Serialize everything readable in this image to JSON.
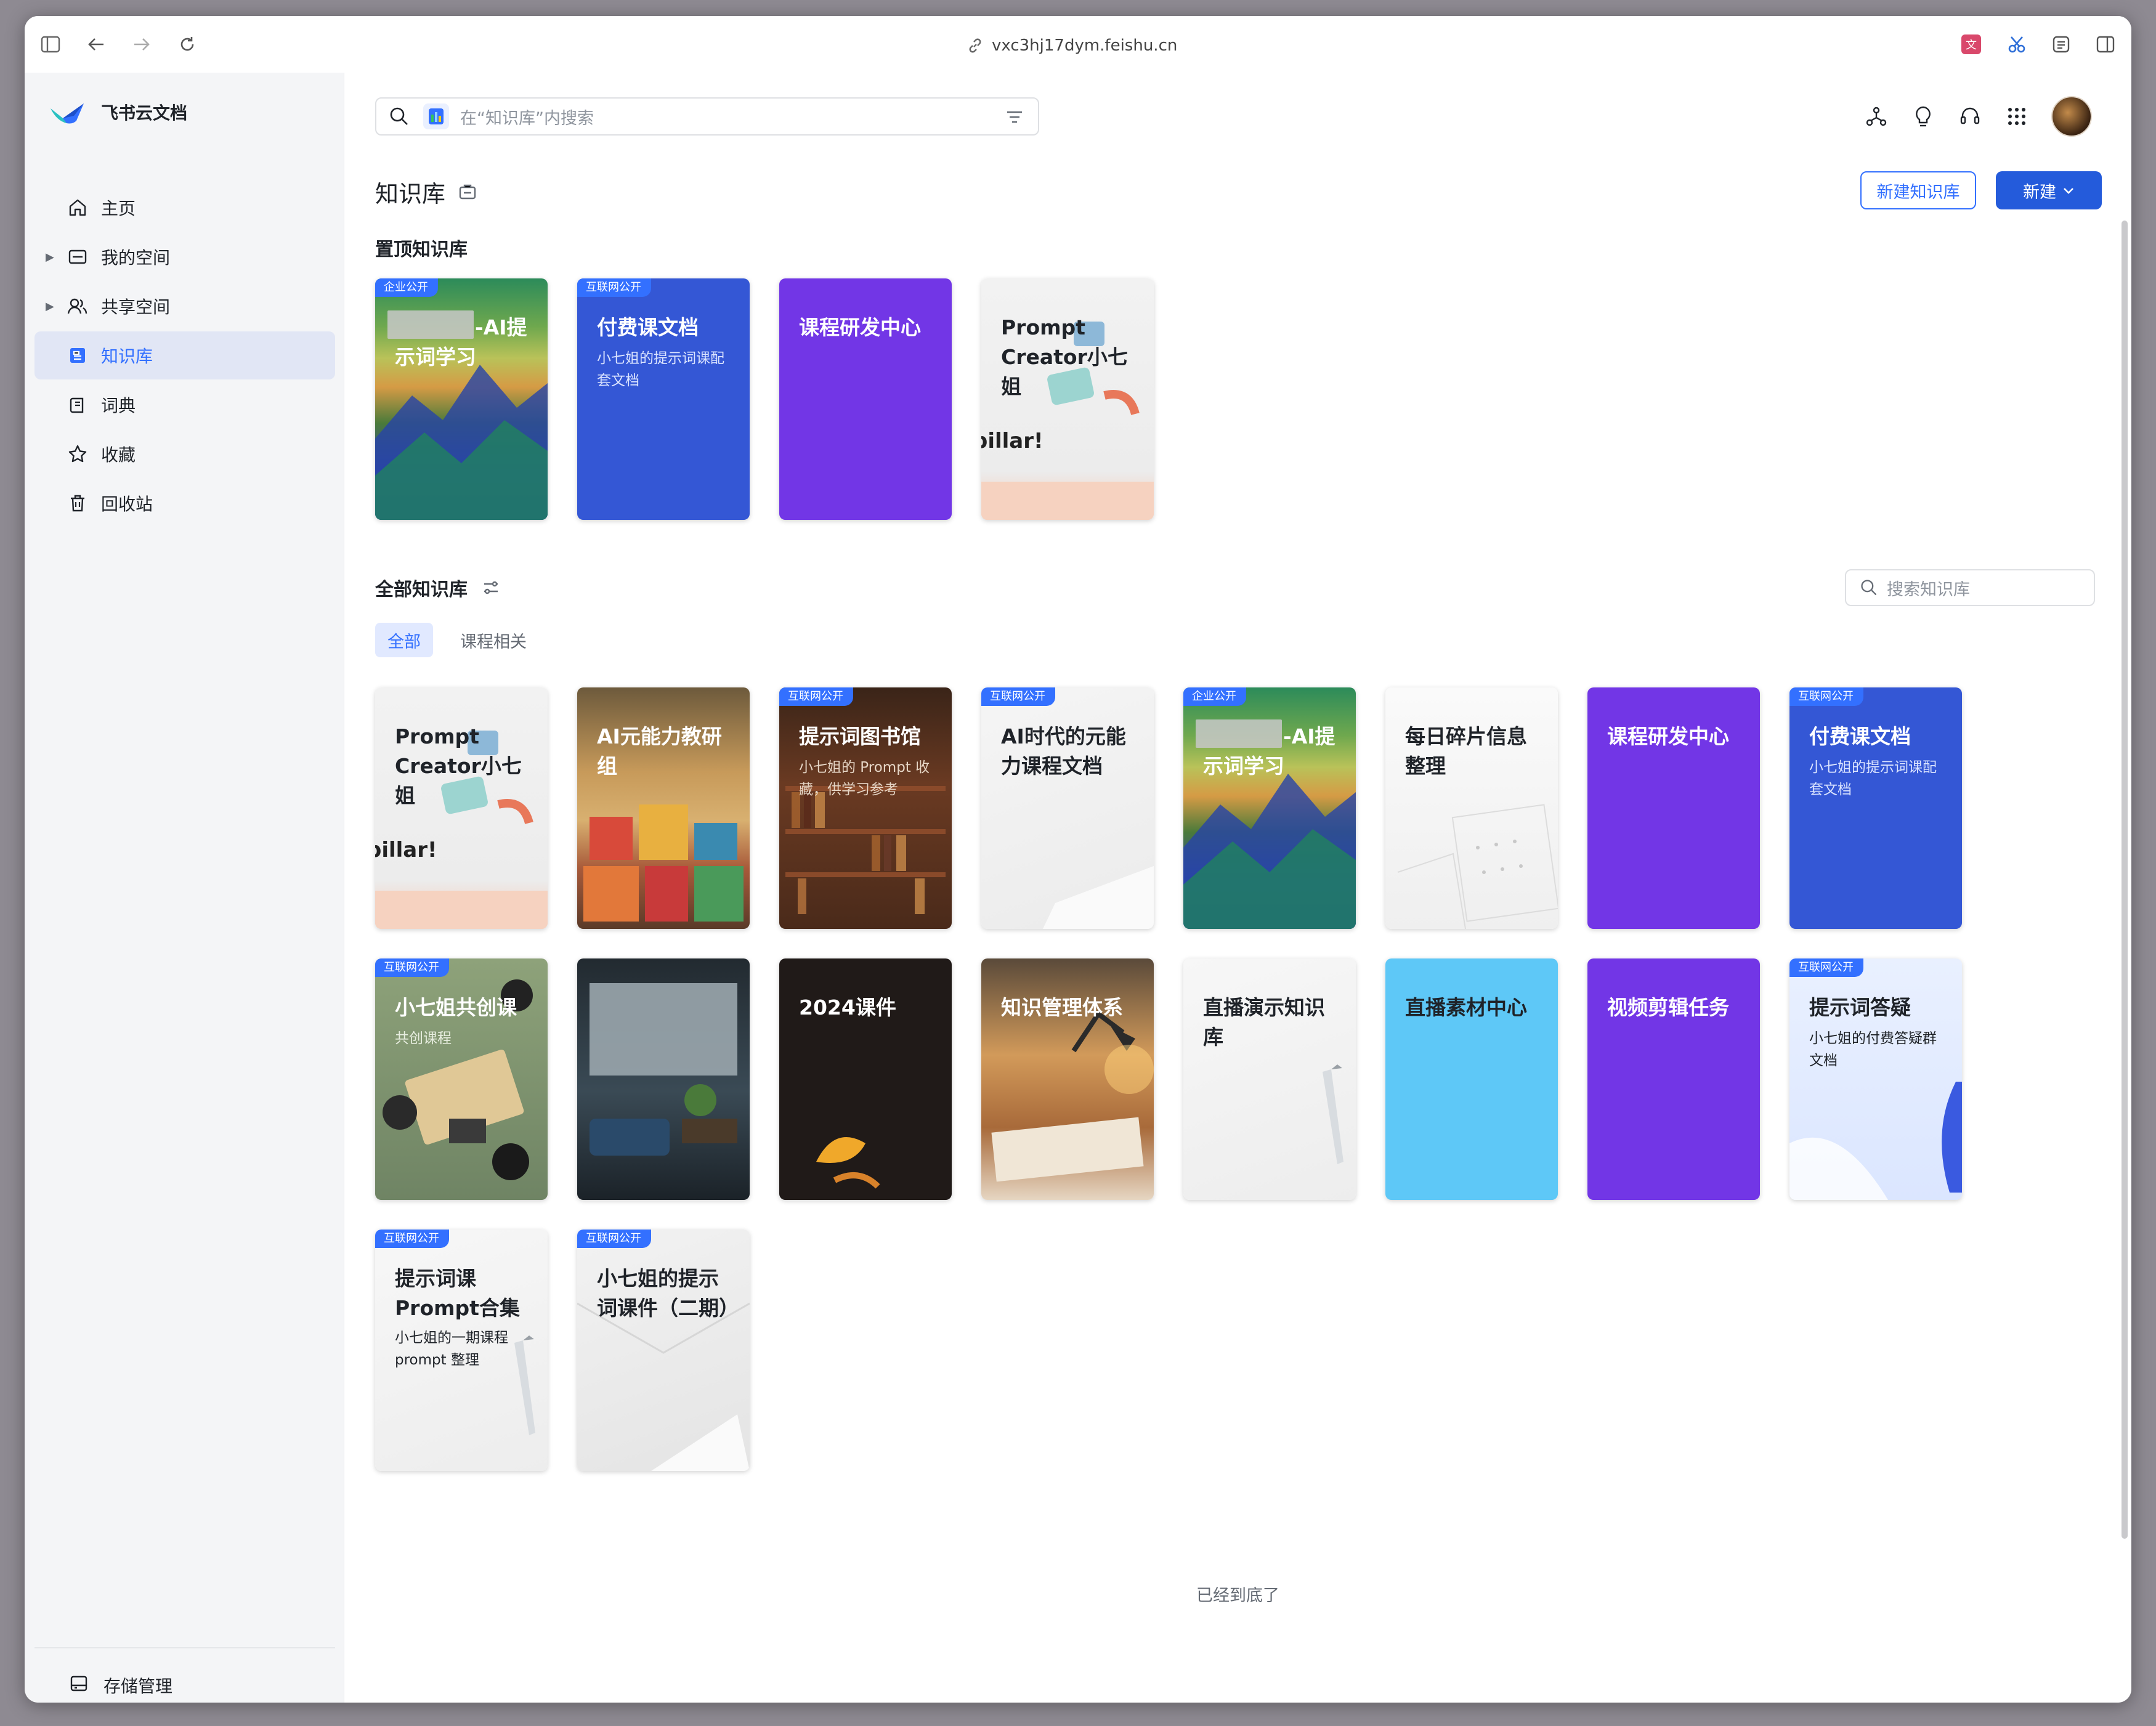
{
  "browser": {
    "url": "vxc3hj17dym.feishu.cn"
  },
  "sidebar": {
    "brand": "飞书云文档",
    "items": [
      {
        "label": "主页",
        "icon": "home-icon",
        "caret": false,
        "active": false
      },
      {
        "label": "我的空间",
        "icon": "folder-icon",
        "caret": true,
        "active": false
      },
      {
        "label": "共享空间",
        "icon": "users-icon",
        "caret": true,
        "active": false
      },
      {
        "label": "知识库",
        "icon": "wiki-icon",
        "caret": false,
        "active": true
      },
      {
        "label": "词典",
        "icon": "dictionary-icon",
        "caret": false,
        "active": false
      },
      {
        "label": "收藏",
        "icon": "star-icon",
        "caret": false,
        "active": false
      },
      {
        "label": "回收站",
        "icon": "trash-icon",
        "caret": false,
        "active": false
      }
    ],
    "storage_label": "存储管理"
  },
  "header": {
    "search_placeholder": "在“知识库”内搜索",
    "page_title": "知识库",
    "new_wiki_label": "新建知识库",
    "new_label": "新建"
  },
  "pinned": {
    "title": "置顶知识库"
  },
  "all": {
    "title": "全部知识库",
    "search_placeholder": "搜索知识库",
    "filters": [
      "全部",
      "课程相关"
    ],
    "active_filter": "全部",
    "end_text": "已经到底了"
  },
  "tags": {
    "enterprise": "企业公开",
    "internet": "互联网公开"
  },
  "cards": {
    "p1": {
      "title": "-AI提示词学习",
      "tag": "企业公开"
    },
    "p2": {
      "title": "付费课文档",
      "desc": "小七姐的提示词课配套文档",
      "tag": "互联网公开"
    },
    "p3": {
      "title": "课程研发中心"
    },
    "p4": {
      "title": "Prompt Creator小七姐",
      "art_text": "pillar!"
    },
    "a1": {
      "title": "Prompt Creator小七姐",
      "art_text": "pillar!"
    },
    "a2": {
      "title": "AI元能力教研组"
    },
    "a3": {
      "title": "提示词图书馆",
      "desc": "小七姐的 Prompt 收藏，供学习参考",
      "tag": "互联网公开"
    },
    "a4": {
      "title": "AI时代的元能力课程文档",
      "tag": "互联网公开"
    },
    "a5": {
      "title": "-AI提示词学习",
      "tag": "企业公开"
    },
    "a6": {
      "title": "每日碎片信息整理"
    },
    "a7": {
      "title": "课程研发中心"
    },
    "a8": {
      "title": "付费课文档",
      "desc": "小七姐的提示词课配套文档",
      "tag": "互联网公开"
    },
    "b1": {
      "title": "小七姐共创课",
      "desc": "共创课程",
      "tag": "互联网公开"
    },
    "b2": {
      "title": ""
    },
    "b3": {
      "title": "2024课件"
    },
    "b4": {
      "title": "知识管理体系"
    },
    "b5": {
      "title": "直播演示知识库"
    },
    "b6": {
      "title": "直播素材中心"
    },
    "b7": {
      "title": "视频剪辑任务"
    },
    "b8": {
      "title": "提示词答疑",
      "desc": "小七姐的付费答疑群文档",
      "tag": "互联网公开"
    },
    "c1": {
      "title": "提示词课Prompt合集",
      "desc": "小七姐的一期课程prompt 整理",
      "tag": "互联网公开"
    },
    "c2": {
      "title": "小七姐的提示词课件（二期）",
      "tag": "互联网公开"
    }
  },
  "colors": {
    "accent": "#3370ff",
    "primary_button": "#245bdb",
    "card_blue": "#3457d5",
    "card_purple": "#7236e6",
    "card_cyan": "#5ec8f7",
    "card_dark": "#201a18"
  }
}
